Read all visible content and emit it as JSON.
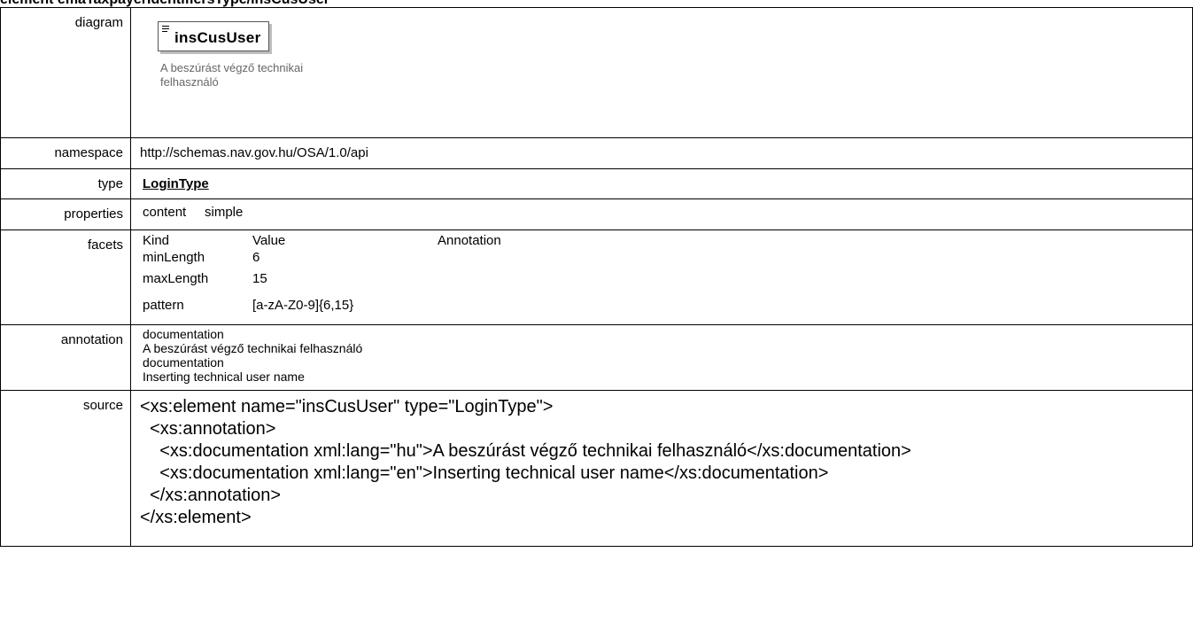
{
  "heading": "element emaTaxpayerIdentifiersType/insCusUser",
  "rows": {
    "diagram": {
      "label": "diagram",
      "element_name": "insCusUser",
      "note": "A beszúrást végző technikai felhasználó"
    },
    "namespace": {
      "label": "namespace",
      "value": "http://schemas.nav.gov.hu/OSA/1.0/api"
    },
    "type": {
      "label": "type",
      "value": "LoginType"
    },
    "properties": {
      "label": "properties",
      "key": "content",
      "value": "simple"
    },
    "facets": {
      "label": "facets",
      "headers": [
        "Kind",
        "Value",
        "Annotation"
      ],
      "items": [
        {
          "kind": "minLength",
          "value": "6",
          "annotation": ""
        },
        {
          "kind": "maxLength",
          "value": "15",
          "annotation": ""
        },
        {
          "kind": "pattern",
          "value": "[a-zA-Z0-9]{6,15}",
          "annotation": ""
        }
      ]
    },
    "annotation": {
      "label": "annotation",
      "lines": [
        "documentation",
        "A beszúrást végző technikai felhasználó",
        "documentation",
        "Inserting technical user name"
      ]
    },
    "source": {
      "label": "source",
      "lines": [
        "<xs:element name=\"insCusUser\" type=\"LoginType\">",
        "  <xs:annotation>",
        "    <xs:documentation xml:lang=\"hu\">A beszúrást végző technikai felhasználó</xs:documentation>",
        "    <xs:documentation xml:lang=\"en\">Inserting technical user name</xs:documentation>",
        "  </xs:annotation>",
        "</xs:element>"
      ]
    }
  }
}
